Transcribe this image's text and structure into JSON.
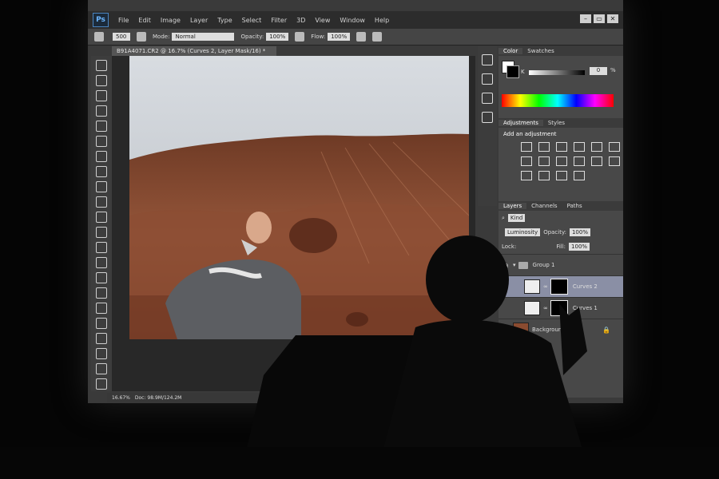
{
  "app": {
    "logo": "Ps",
    "menu": [
      "File",
      "Edit",
      "Image",
      "Layer",
      "Type",
      "Select",
      "Filter",
      "3D",
      "View",
      "Window",
      "Help"
    ],
    "window_controls": [
      "minimize",
      "restore",
      "close"
    ]
  },
  "options_bar": {
    "brush_size": "500",
    "mode_label": "Mode:",
    "mode_value": "Normal",
    "opacity_label": "Opacity:",
    "opacity_value": "100%",
    "flow_label": "Flow:",
    "flow_value": "100%"
  },
  "document": {
    "tab_title": "B91A4071.CR2 @ 16.7% (Curves 2, Layer Mask/16) *"
  },
  "status": {
    "zoom": "16.67%",
    "doc": "Doc: 98.9M/124.2M"
  },
  "color_panel": {
    "tabs": [
      "Color",
      "Swatches"
    ],
    "channel_label": "K",
    "value": "0",
    "unit": "%"
  },
  "adjustments_panel": {
    "tabs": [
      "Adjustments",
      "Styles"
    ],
    "title": "Add an adjustment"
  },
  "layers_panel": {
    "tabs": [
      "Layers",
      "Channels",
      "Paths"
    ],
    "filter": "Kind",
    "blend_mode": "Luminosity",
    "opacity_label": "Opacity:",
    "opacity_value": "100%",
    "lock_label": "Lock:",
    "fill_label": "Fill:",
    "fill_value": "100%",
    "layers": [
      {
        "name": "Group 1"
      },
      {
        "name": "Curves 2"
      },
      {
        "name": "Curves 1"
      },
      {
        "name": "Background"
      }
    ]
  },
  "colors": {
    "ui_dark": "#3a3a3a",
    "selection": "#8a8fa5",
    "sky": "#c9ced4",
    "soil": "#8a4b30"
  }
}
